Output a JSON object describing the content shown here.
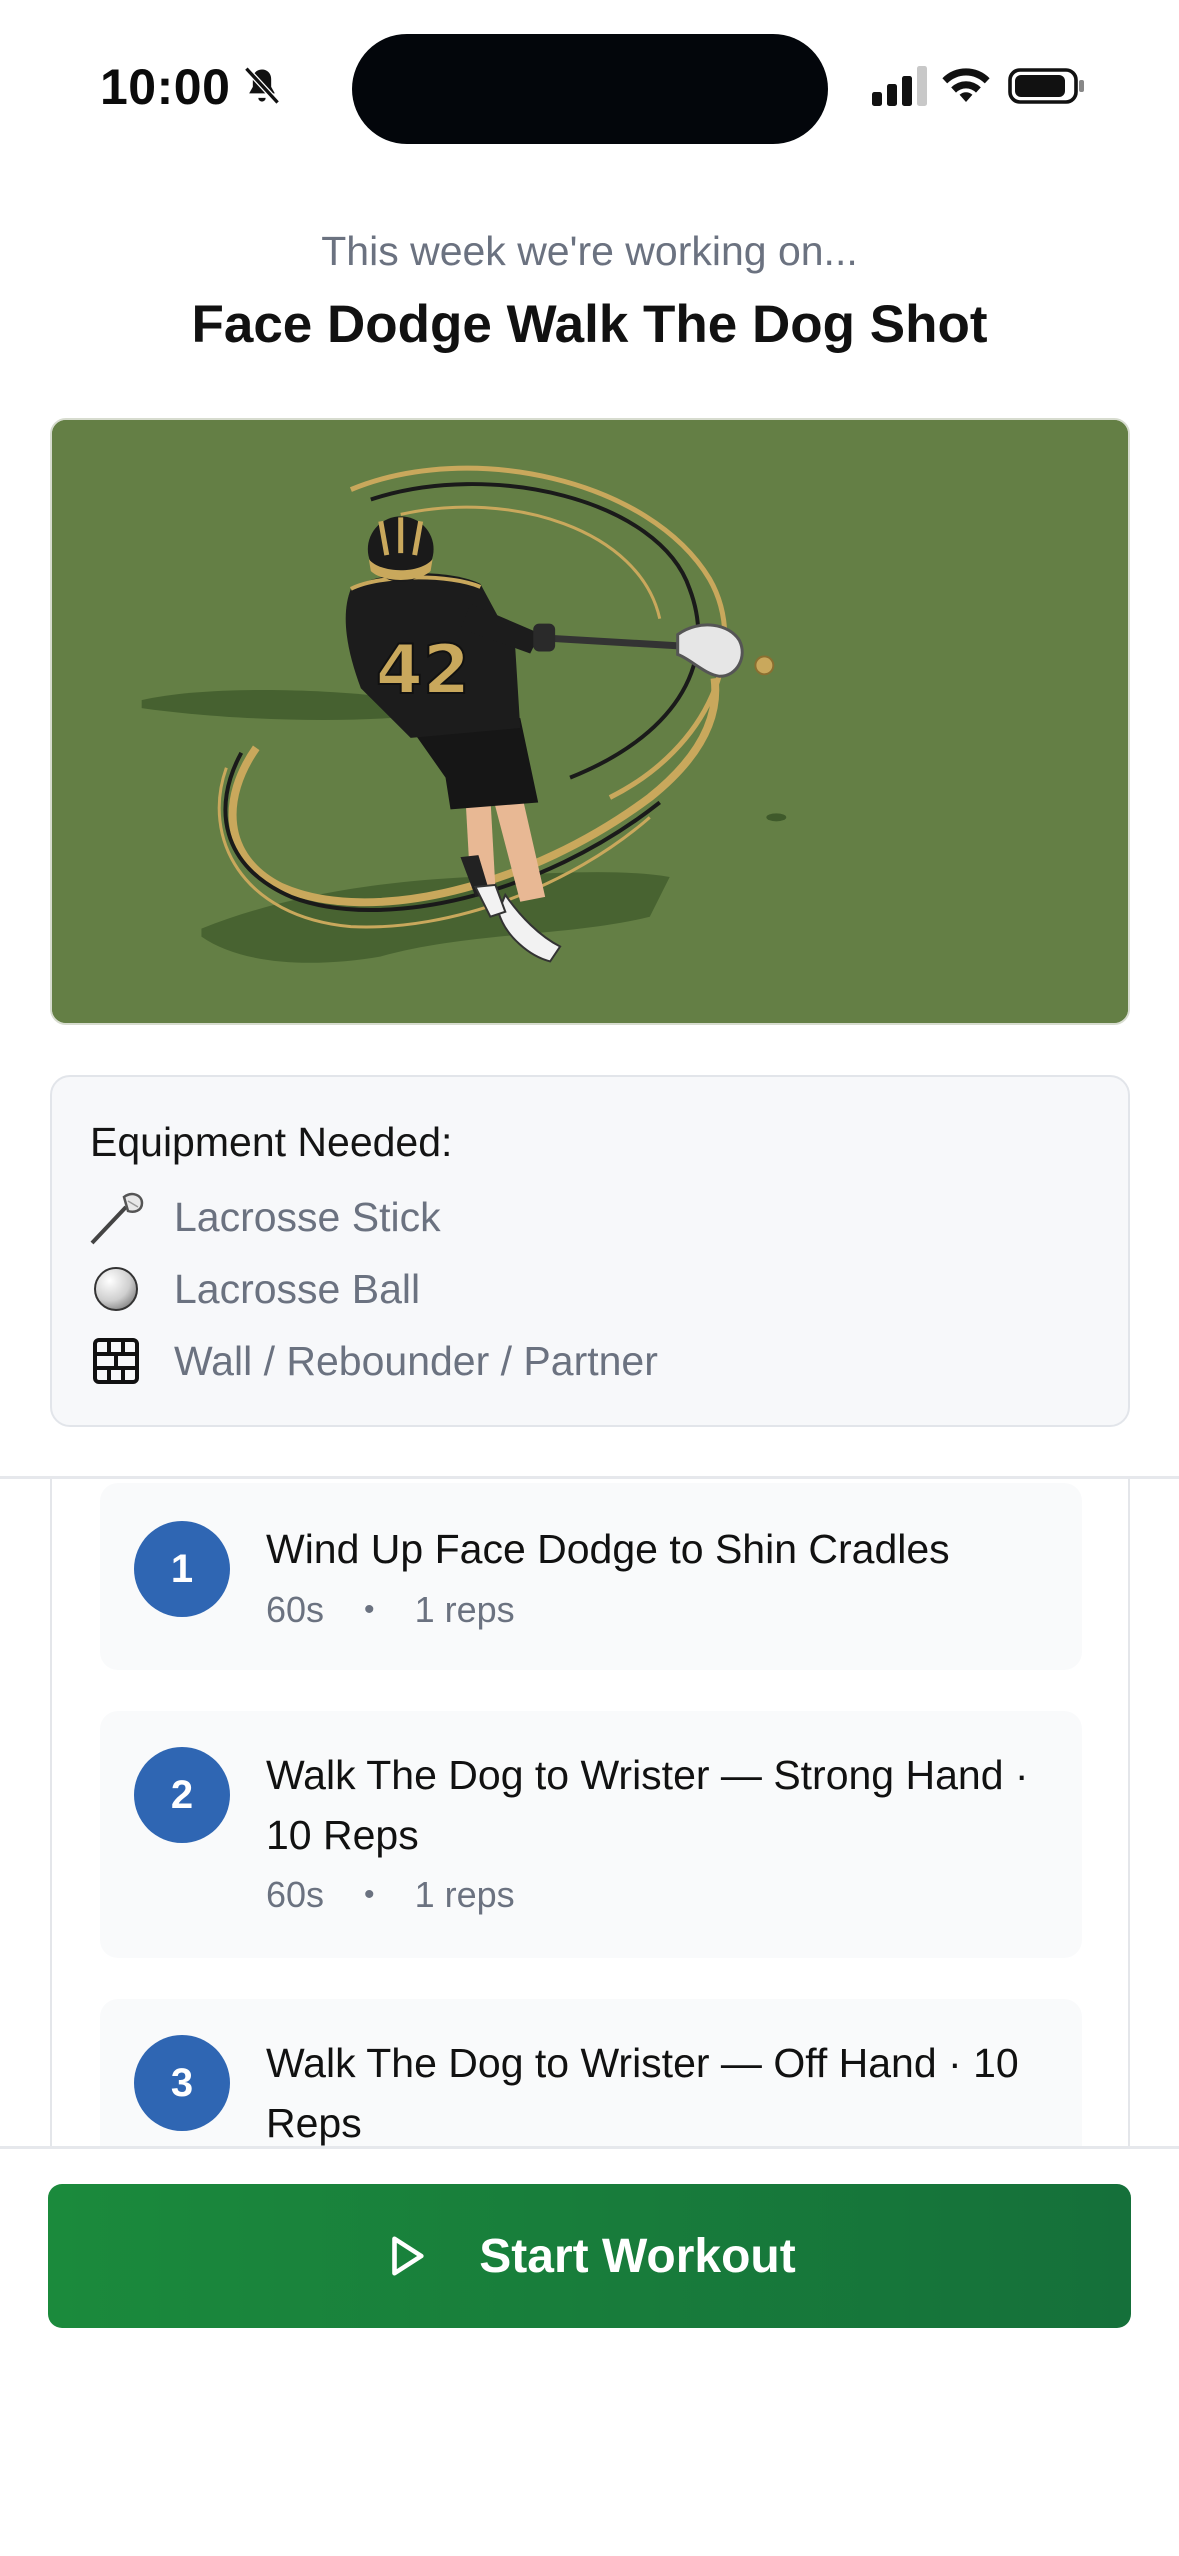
{
  "status_bar": {
    "time": "10:00",
    "icons": [
      "bell-slash-icon",
      "cellular-signal-icon",
      "wifi-icon",
      "battery-icon"
    ]
  },
  "header": {
    "subtitle": "This week we're working on...",
    "title": "Face Dodge Walk The Dog Shot"
  },
  "hero": {
    "jersey_number": "42",
    "colors": {
      "field": "#647f45",
      "accent_gold": "#c9a85c"
    }
  },
  "equipment": {
    "title": "Equipment Needed:",
    "items": [
      {
        "icon": "lacrosse-stick-icon",
        "label": "Lacrosse Stick"
      },
      {
        "icon": "lacrosse-ball-icon",
        "label": "Lacrosse Ball"
      },
      {
        "icon": "wall-grid-icon",
        "label": "Wall / Rebounder / Partner"
      }
    ]
  },
  "exercises": [
    {
      "number": "1",
      "name": "Wind Up Face Dodge to Shin Cradles",
      "duration": "60s",
      "reps": "1 reps"
    },
    {
      "number": "2",
      "name": "Walk The Dog to Wrister — Strong Hand · 10 Reps",
      "duration": "60s",
      "reps": "1 reps"
    },
    {
      "number": "3",
      "name": "Walk The Dog to Wrister — Off Hand · 10 Reps",
      "duration": "",
      "reps": ""
    }
  ],
  "start_button": {
    "label": "Start Workout",
    "icon": "play-icon",
    "color": "#1b8a3c"
  },
  "theme": {
    "number_badge": "#2f66b3",
    "muted_text": "#6b7280"
  }
}
